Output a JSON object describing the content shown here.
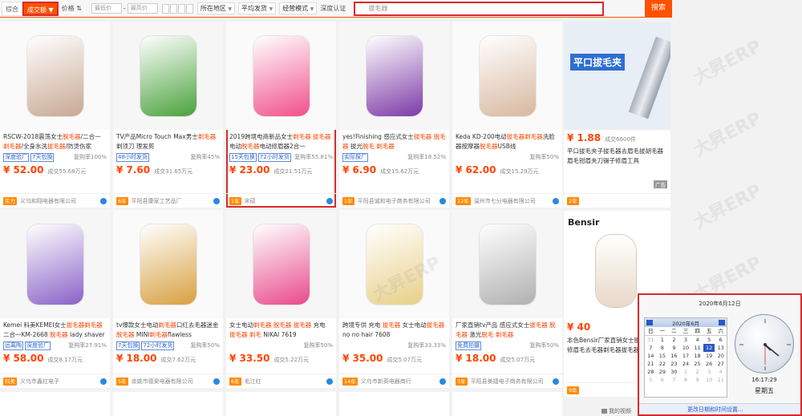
{
  "filter_bar": {
    "sort_default": "综合",
    "sort_sales": "成交额",
    "sort_price": "价格",
    "price_min_placeholder": "最低价",
    "price_max_placeholder": "最高价",
    "location": "所在地区",
    "avg_shipping": "平均发货",
    "biz_mode": "经营模式",
    "deep_cert": "深度认证",
    "keyword": "拔毛器",
    "search": "搜索"
  },
  "products": [
    {
      "title": "RSCW-2018震荡女士脱毛器/二合一剃毛器/全身水洗拔毛器/防烫伤家",
      "tags": [
        "深度验厂",
        "7天包换"
      ],
      "rate": "复购率100%",
      "price": "¥ 52.00",
      "sold": "成交55.68万元",
      "shop": "义乌和翔电器有限公司",
      "year": "实力",
      "pic_color": "#c8a892"
    },
    {
      "title": "TV产品Micro Touch Max男士剃毛器剃须刀 理发剪",
      "tags": [
        "48小时发货"
      ],
      "rate": "复购率45%",
      "price": "¥ 7.60",
      "sold": "成交31.65万元",
      "shop": "平阳县康家工艺品厂",
      "year": "6年",
      "pic_color": "#4aa23c"
    },
    {
      "title": "2019跨境电商新品女士剃毛器 拔毛器电动脱毛器电动修眉器2合一",
      "tags": [
        "15天包换",
        "72小时发货"
      ],
      "rate": "复购率55.81%",
      "price": "¥ 23.00",
      "sold": "成交21.51万元",
      "shop": "宋硕",
      "year": "1年",
      "pic_color": "#f24f8a"
    },
    {
      "title": "yes!Finishing 感应式女士拔毛器 脱毛器 拔光脱毛 剃毛器",
      "tags": [
        "实际探厂"
      ],
      "rate": "复购率18.52%",
      "price": "¥ 6.90",
      "sold": "成交15.62万元",
      "shop": "平阳县诚和电子商务有限公司",
      "year": "1年",
      "pic_color": "#7d3aa8"
    },
    {
      "title": "Keda KD-200电动拔毛器剃毛器洗脸器按摩器脱毛器USB线",
      "tags": [],
      "rate": "复购率50%",
      "price": "¥ 62.00",
      "sold": "成交15.29万元",
      "shop": "温州市七分电器有限公司",
      "year": "12年",
      "pic_color": "#d8b8a0"
    },
    {
      "title": "Kemei 科美KEMEI女士拔毛器剃毛器二合一KM-2668 脱毛器 lady shaver",
      "tags": [
        "远离陶",
        "深度验厂"
      ],
      "rate": "复购率27.91%",
      "price": "¥ 58.00",
      "sold": "成交8.17万元",
      "shop": "义乌市鑫红电子",
      "year": "科美",
      "pic_color": "#8a62c8"
    },
    {
      "title": "tv爆款女士电动剃毛器口红去毛器迷金脱毛器 MINI剃毛器flawless",
      "tags": [
        "7天包换",
        "72小时发货"
      ],
      "rate": "复购率50%",
      "price": "¥ 18.00",
      "sold": "成交7.62万元",
      "shop": "余姚市德昊电器有限公司",
      "year": "5年",
      "pic_color": "#d8a040"
    },
    {
      "title": "女士电动剃毛器 脱毛器 拔毛器 充电 拔毛器 剃毛 NIKAI 7619",
      "tags": [],
      "rate": "复购率50%",
      "price": "¥ 33.50",
      "sold": "成交5.22万元",
      "shop": "毛江红",
      "year": "6年",
      "pic_color": "#e84a8a"
    },
    {
      "title": "跨境专供 充电 拔毛器 女士电动拔毛器 no no hair 7608",
      "tags": [],
      "rate": "复购率33.33%",
      "price": "¥ 35.00",
      "sold": "成交5.07万元",
      "shop": "义乌市新英电器商行",
      "year": "14年",
      "pic_color": "#e8d088"
    },
    {
      "title": "厂家直销tv产品 感应式女士拔毛器 脱毛器 激光脱毛 剃毛器",
      "tags": [
        "免费拍摄"
      ],
      "rate": "复购率50%",
      "price": "¥ 18.00",
      "sold": "成交5.07万元",
      "shop": "平阳县美捷电子商务有限公司",
      "year": "3年",
      "pic_color": "#b0b0b0"
    }
  ],
  "right_products": [
    {
      "title": "平口拔毛夹子拔毛器去眉毛拔胡毛器眉毛钳眉夹刀镊子修眉工具",
      "price": "¥ 1.88",
      "sold": "成交6600件",
      "year": "2年",
      "ad": "广告",
      "banner": "平口拔毛夹",
      "pic_color": "#7ba8d8"
    },
    {
      "title": "本色Bensir厂家直销女士脱毛器电动修眉毛去毛器剃毛器拔毛器",
      "price": "¥ 40",
      "sold": "成交",
      "year": "9年",
      "brand": "Bensir",
      "pic_color": "#c89068"
    }
  ],
  "watermark": "大昇ERP",
  "clock": {
    "date": "2020年6月12日",
    "month_year": "2020年6月",
    "weekdays": [
      "日",
      "一",
      "二",
      "三",
      "四",
      "五",
      "六"
    ],
    "days": [
      "31",
      "1",
      "2",
      "3",
      "4",
      "5",
      "6",
      "7",
      "8",
      "9",
      "10",
      "11",
      "12",
      "13",
      "14",
      "15",
      "16",
      "17",
      "18",
      "19",
      "20",
      "21",
      "22",
      "23",
      "24",
      "25",
      "26",
      "27",
      "28",
      "29",
      "30",
      "1",
      "2",
      "3",
      "4",
      "5",
      "6",
      "7",
      "8",
      "9",
      "10",
      "11"
    ],
    "today": "12",
    "time": "16:17:29",
    "weekday": "星期五",
    "change_link": "更改日期和时间设置..."
  },
  "video_badge": "我的视频"
}
